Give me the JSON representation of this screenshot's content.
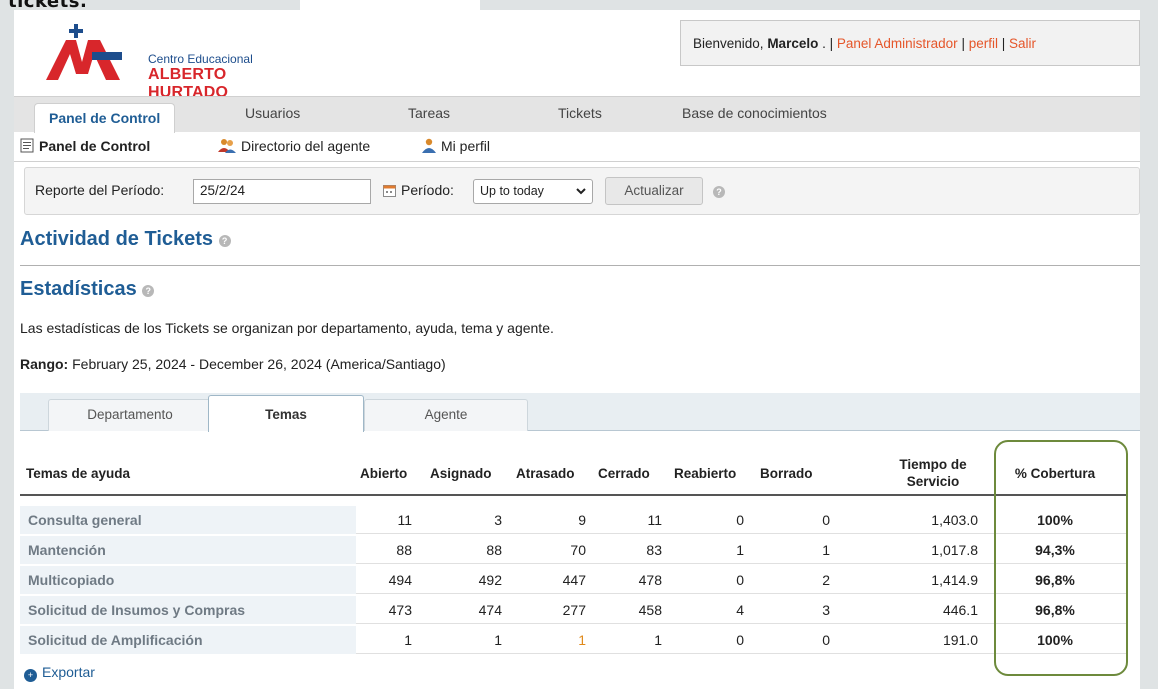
{
  "top_cut_text": "tickets.",
  "logo": {
    "line1": "Centro Educacional",
    "line2": "ALBERTO HURTADO"
  },
  "userbar": {
    "welcome": "Bienvenido, ",
    "user": "Marcelo",
    "after_user": " . | ",
    "admin": "Panel Administrador",
    "sep": " | ",
    "profile": "perfil",
    "logout": "Salir"
  },
  "nav": {
    "tabs": [
      "Panel de Control",
      "Usuarios",
      "Tareas",
      "Tickets",
      "Base de conocimientos"
    ]
  },
  "subnav": {
    "items": [
      "Panel de Control",
      "Directorio del agente",
      "Mi perfil"
    ]
  },
  "filter": {
    "report_label": "Reporte del Período:",
    "date_value": "25/2/24",
    "period_label": "Período:",
    "period_value": "Up to today",
    "refresh_label": "Actualizar"
  },
  "activity_title": "Actividad de Tickets",
  "stats_title": "Estadísticas",
  "description": "Las estadísticas de los Tickets se organizan por departamento, ayuda, tema y agente.",
  "range": {
    "label": "Rango:",
    "value": " February 25, 2024 - December 26, 2024 (America/Santiago)"
  },
  "stat_tabs": [
    "Departamento",
    "Temas",
    "Agente"
  ],
  "table": {
    "headers": {
      "topic": "Temas de ayuda",
      "open": "Abierto",
      "assigned": "Asignado",
      "overdue": "Atrasado",
      "closed": "Cerrado",
      "reopened": "Reabierto",
      "deleted": "Borrado",
      "service_1": "Tiempo de",
      "service_2": "Servicio",
      "coverage": "% Cobertura"
    },
    "rows": [
      {
        "topic": "Consulta general",
        "open": "11",
        "assigned": "3",
        "overdue": "9",
        "closed": "11",
        "reopened": "0",
        "deleted": "0",
        "service": "1,403.0",
        "coverage": "100%"
      },
      {
        "topic": "Mantención",
        "open": "88",
        "assigned": "88",
        "overdue": "70",
        "closed": "83",
        "reopened": "1",
        "deleted": "1",
        "service": "1,017.8",
        "coverage": "94,3%"
      },
      {
        "topic": "Multicopiado",
        "open": "494",
        "assigned": "492",
        "overdue": "447",
        "closed": "478",
        "reopened": "0",
        "deleted": "2",
        "service": "1,414.9",
        "coverage": "96,8%"
      },
      {
        "topic": "Solicitud de Insumos y Compras",
        "open": "473",
        "assigned": "474",
        "overdue": "277",
        "closed": "458",
        "reopened": "4",
        "deleted": "3",
        "service": "446.1",
        "coverage": "96,8%"
      },
      {
        "topic": "Solicitud de Amplificación",
        "open": "1",
        "assigned": "1",
        "overdue": "1",
        "closed": "1",
        "reopened": "0",
        "deleted": "0",
        "service": "191.0",
        "coverage": "100%"
      }
    ]
  },
  "export_label": "Exportar",
  "colors": {
    "accent_blue": "#1f5d95",
    "link_orange": "#e5562a",
    "highlight_green": "#6d8a3c"
  }
}
